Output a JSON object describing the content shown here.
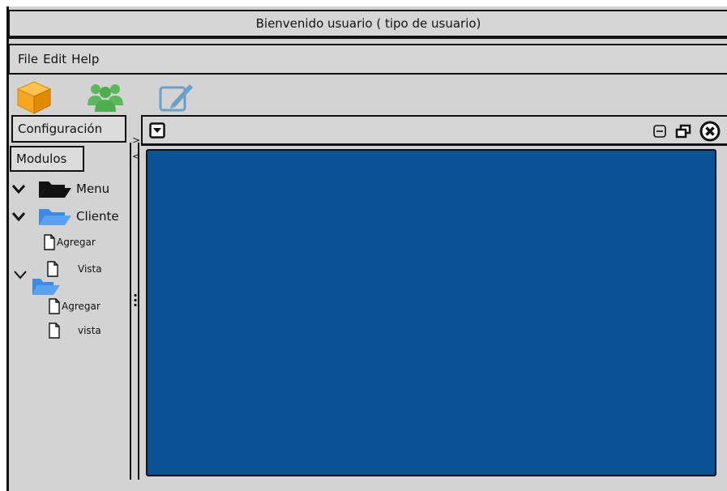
{
  "window": {
    "title": "Bienvenido usuario ( tipo de usuario)"
  },
  "menu": {
    "file": "File",
    "edit": "Edit",
    "help": "Help"
  },
  "toolbar": {
    "icons": [
      "box-icon",
      "users-icon",
      "edit-icon"
    ]
  },
  "tabs": {
    "configuracion": "Configuración",
    "modulos": "Modulos"
  },
  "tree": {
    "menu_label": "Menu",
    "cliente_label": "Cliente",
    "cliente_agregar": "Agregar",
    "cliente_vista": "Vista",
    "other_agregar": "Agregar",
    "other_vista": "vista"
  },
  "colors": {
    "content_bg": "#0b5195",
    "folder_blue": "#3b8be6",
    "box_orange": "#f5a623",
    "users_green": "#5cb85c",
    "edit_blue": "#6aa0c8"
  }
}
